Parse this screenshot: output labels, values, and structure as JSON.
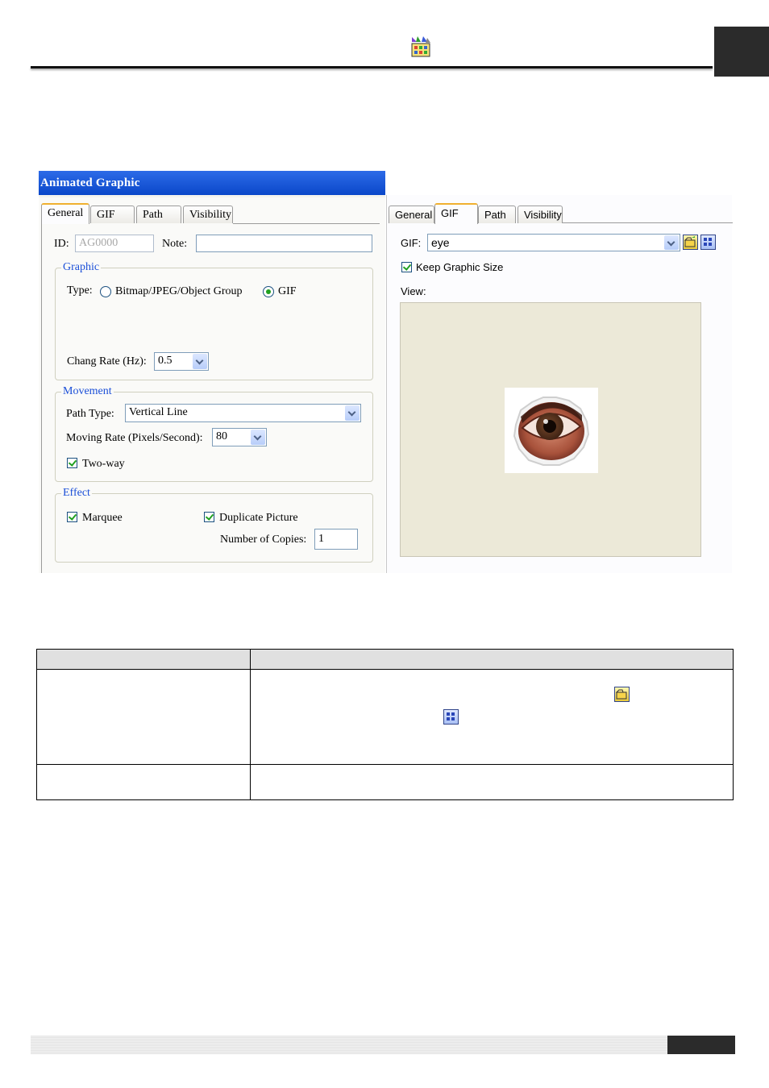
{
  "dialog": {
    "title": "Animated Graphic",
    "left_tabs": [
      "General",
      "GIF",
      "Path",
      "Visibility"
    ],
    "right_tabs": [
      "General",
      "GIF",
      "Path",
      "Visibility"
    ],
    "id_label": "ID:",
    "id_value": "AG0000",
    "note_label": "Note:",
    "note_value": "",
    "graphic": {
      "title": "Graphic",
      "type_label": "Type:",
      "option_bitmap": "Bitmap/JPEG/Object Group",
      "option_gif": "GIF",
      "selected": "GIF",
      "rate_label": "Chang Rate (Hz):",
      "rate_value": "0.5"
    },
    "movement": {
      "title": "Movement",
      "path_type_label": "Path Type:",
      "path_type_value": "Vertical Line",
      "moving_rate_label": "Moving Rate (Pixels/Second):",
      "moving_rate_value": "80",
      "two_way_label": "Two-way",
      "two_way_checked": true
    },
    "effect": {
      "title": "Effect",
      "marquee_label": "Marquee",
      "marquee_checked": true,
      "duplicate_label": "Duplicate Picture",
      "duplicate_checked": true,
      "copies_label": "Number of Copies:",
      "copies_value": "1"
    },
    "gif_tab": {
      "gif_label": "GIF:",
      "gif_value": "eye",
      "keep_size_label": "Keep Graphic Size",
      "keep_size_checked": true,
      "view_label": "View:",
      "preview": "eye-image"
    }
  },
  "colors": {
    "title_bar": "#0a47c9",
    "group_title": "#1b4fd8",
    "check": "#21a121",
    "preview_bg": "#ece9d8"
  }
}
